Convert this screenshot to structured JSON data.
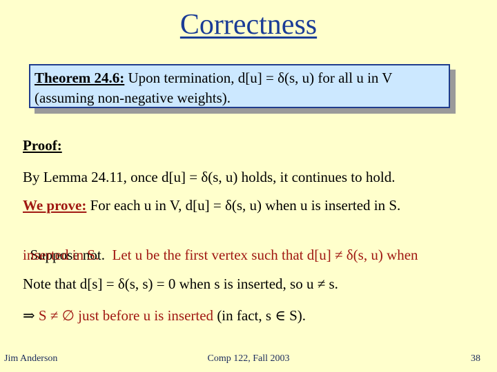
{
  "slide": {
    "title": "Correctness",
    "theorem": {
      "label": "Theorem 24.6:",
      "line1": " Upon termination, d[u] = δ(s, u) for all u in V",
      "line2": "(assuming non-negative weights)."
    },
    "proof": {
      "label": "Proof:",
      "lemma_line": "By Lemma 24.11, once d[u] = δ(s, u) holds, it continues to hold.",
      "we_prove_label": "We prove:",
      "we_prove_text": " For each u in V, d[u] = δ(s, u) when u is inserted in S.",
      "suppose_black": "Suppose not.  ",
      "suppose_red_line1": "Let u be the first vertex such that d[u] ≠ δ(s, u) when",
      "suppose_red_line2": "inserted in S.",
      "note_line": "Note that d[s] = δ(s, s) = 0 when s is inserted, so u ≠ s.",
      "implies_symbol": "⇒",
      "implies_red": " S ≠ ∅ just before u is inserted",
      "implies_black": " (in fact, s ∈ S)."
    },
    "footer": {
      "author": "Jim Anderson",
      "course": "Comp 122, Fall 2003",
      "page_number": "38"
    },
    "colors": {
      "background": "#ffffcc",
      "title": "#1a3c96",
      "theorem_box": "#cce8ff",
      "theorem_border": "#1f3c8c",
      "emphasis_red": "#a01812"
    }
  }
}
